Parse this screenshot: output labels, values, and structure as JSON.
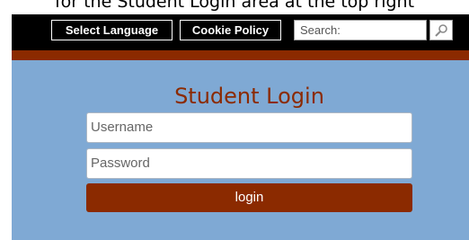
{
  "caption": "for the Student Login area at the top right",
  "topbar": {
    "select_language_label": "Select Language",
    "cookie_policy_label": "Cookie Policy",
    "search_placeholder": "Search:",
    "search_icon": "magnifier-icon"
  },
  "login": {
    "title": "Student Login",
    "username_placeholder": "Username",
    "password_placeholder": "Password",
    "login_label": "login"
  },
  "colors": {
    "topbar": "#000000",
    "accent": "#8b2a00",
    "panel": "#7fa9d4"
  }
}
